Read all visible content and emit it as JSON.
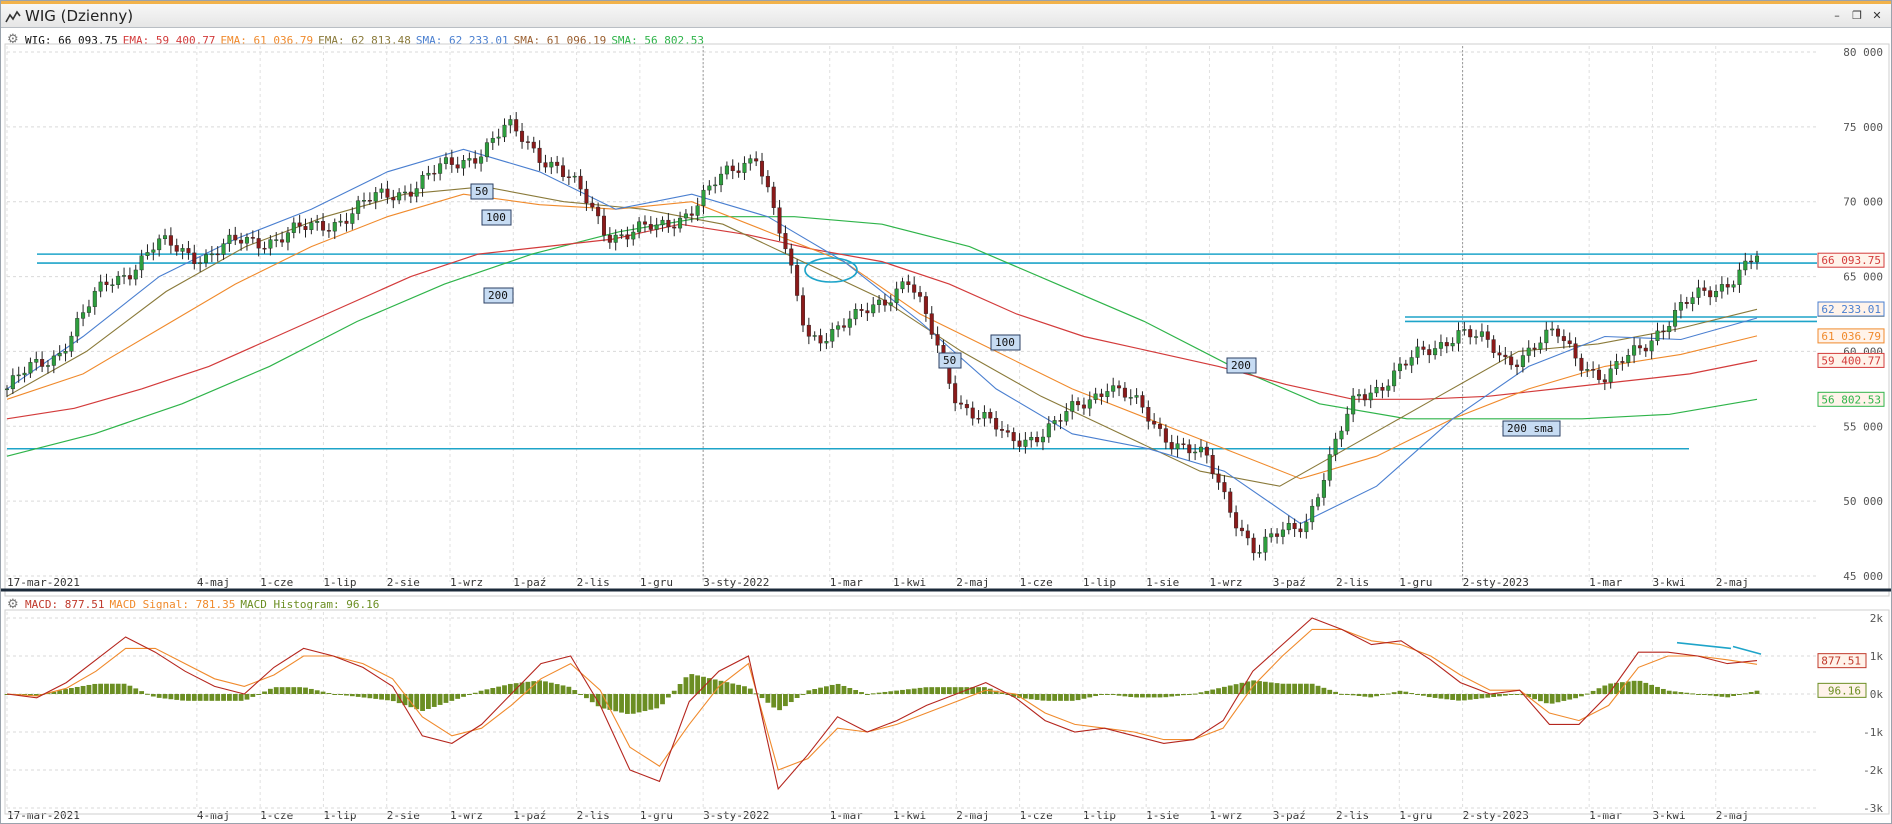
{
  "window": {
    "title": "WIG (Dzienny)",
    "buttons": [
      "–",
      "❐",
      "✕"
    ]
  },
  "legend_main": [
    {
      "text": "WIG: 66 093.75",
      "color": "#111111"
    },
    {
      "text": "EMA: 59 400.77",
      "color": "#d33b3b"
    },
    {
      "text": "EMA: 61 036.79",
      "color": "#f08a2c"
    },
    {
      "text": "EMA: 62 813.48",
      "color": "#8a7a3a"
    },
    {
      "text": "SMA: 62 233.01",
      "color": "#4a7fd0"
    },
    {
      "text": "SMA: 61 096.19",
      "color": "#9a5e2e"
    },
    {
      "text": "SMA: 56 802.53",
      "color": "#2fb44a"
    }
  ],
  "legend_macd": [
    {
      "text": "MACD: 877.51",
      "color": "#c0392b"
    },
    {
      "text": "MACD Signal: 781.35",
      "color": "#f08a2c"
    },
    {
      "text": "MACD Histogram: 96.16",
      "color": "#6b8e23"
    }
  ],
  "annotations": {
    "ma50_a": "50",
    "ma100_a": "100",
    "ma200_a": "200",
    "ma50_b": "50",
    "ma100_b": "100",
    "ma200_b": "200",
    "sma200": "200 sma"
  },
  "price_labels": [
    {
      "text": "66 093.75",
      "value": 66093.75,
      "color": "#d33b3b"
    },
    {
      "text": "62 813.48",
      "value": 62813.48,
      "color": "#8a7a3a"
    },
    {
      "text": "62 233.01",
      "value": 62233.01,
      "color": "#4a7fd0"
    },
    {
      "text": "61 036.79",
      "value": 61036.79,
      "color": "#f08a2c"
    },
    {
      "text": "59 400.77",
      "value": 59400.77,
      "color": "#d33b3b"
    },
    {
      "text": "56 802.53",
      "value": 56802.53,
      "color": "#2fb44a"
    }
  ],
  "macd_labels": [
    {
      "text": "877.51",
      "value": 877.51,
      "color": "#c0392b"
    },
    {
      "text": "96.16",
      "value": 96.16,
      "color": "#6b8e23"
    }
  ],
  "chart_data": [
    {
      "type": "line",
      "ylim": [
        45000,
        80000
      ],
      "y_ticks": [
        {
          "value": 80000,
          "label": "80 000"
        },
        {
          "value": 75000,
          "label": "75 000"
        },
        {
          "value": 70000,
          "label": "70 000"
        },
        {
          "value": 65000,
          "label": "65 000"
        },
        {
          "value": 60000,
          "label": "60 000"
        },
        {
          "value": 55000,
          "label": "55 000"
        },
        {
          "value": 50000,
          "label": "50 000"
        },
        {
          "value": 45000,
          "label": "45 000"
        }
      ],
      "x_ticks": [
        "17-mar-2021",
        "4-maj",
        "1-cze",
        "1-lip",
        "2-sie",
        "1-wrz",
        "1-paź",
        "2-lis",
        "1-gru",
        "3-sty-2022",
        "1-mar",
        "1-kwi",
        "2-maj",
        "1-cze",
        "1-lip",
        "1-sie",
        "1-wrz",
        "3-paź",
        "2-lis",
        "1-gru",
        "2-sty-2023",
        "1-mar",
        "3-kwi",
        "2-maj"
      ],
      "x_tick_pos": [
        0,
        3,
        4,
        5,
        6,
        7,
        8,
        9,
        10,
        11,
        13,
        14,
        15,
        16,
        17,
        18,
        19,
        20,
        21,
        22,
        23,
        25,
        26,
        27
      ],
      "month_count": 28.6,
      "wig": [
        57500,
        60000,
        64500,
        67000,
        66500,
        67500,
        68000,
        69500,
        71000,
        72500,
        74800,
        72500,
        68000,
        68000,
        70500,
        73500,
        61000,
        62000,
        65000,
        57000,
        54000,
        55000,
        58000,
        55000,
        52500,
        46500,
        49000,
        57000,
        59000,
        61500,
        59500,
        61000,
        58000,
        61500,
        64000,
        66094
      ],
      "ema_red": [
        55500,
        56200,
        57500,
        59000,
        61000,
        63000,
        65000,
        66500,
        67000,
        67500,
        68500,
        67800,
        66800,
        66000,
        64500,
        62500,
        61000,
        60000,
        59000,
        57800,
        56800,
        56800,
        57000,
        57500,
        58000,
        58500,
        59401
      ],
      "ema_orange": [
        56800,
        58500,
        61500,
        64500,
        67000,
        69000,
        70500,
        69800,
        69500,
        70000,
        68000,
        66000,
        62500,
        60000,
        57500,
        55500,
        53500,
        51500,
        53000,
        55500,
        57500,
        59000,
        59800,
        61037
      ],
      "ema_olive": [
        57000,
        60000,
        64000,
        67000,
        69000,
        70500,
        71000,
        70000,
        69500,
        68500,
        66000,
        63500,
        60000,
        57000,
        54500,
        52000,
        51000,
        54000,
        57000,
        60000,
        60500,
        61500,
        62813
      ],
      "sma_blue": [
        57500,
        61000,
        65000,
        67500,
        69500,
        72000,
        73500,
        72000,
        69500,
        70500,
        69000,
        66000,
        62000,
        57500,
        54500,
        53500,
        52000,
        48500,
        51000,
        55500,
        59000,
        61000,
        60800,
        62233
      ],
      "sma_green": [
        53000,
        54500,
        56500,
        59000,
        62000,
        64500,
        66500,
        68000,
        69000,
        69000,
        68500,
        67000,
        64500,
        62000,
        59000,
        56500,
        55500,
        55500,
        55500,
        55800,
        56802
      ],
      "h_levels": [
        66500,
        65900,
        53500,
        62300,
        62000
      ]
    },
    {
      "type": "bar",
      "name_macd": "MACD",
      "ylim": [
        -3000,
        2000
      ],
      "y_ticks": [
        {
          "value": 2000,
          "label": "2k"
        },
        {
          "value": 1000,
          "label": "1k"
        },
        {
          "value": 0,
          "label": "0k"
        },
        {
          "value": -1000,
          "label": "-1k"
        },
        {
          "value": -2000,
          "label": "-2k"
        },
        {
          "value": -3000,
          "label": "-3k"
        }
      ],
      "macd": [
        0,
        -100,
        300,
        900,
        1500,
        1100,
        600,
        200,
        0,
        700,
        1200,
        1000,
        700,
        200,
        -1100,
        -1300,
        -800,
        0,
        800,
        1000,
        -300,
        -2000,
        -2300,
        -200,
        600,
        1000,
        -2500,
        -1600,
        -600,
        -1000,
        -700,
        -300,
        0,
        300,
        -100,
        -700,
        -1000,
        -900,
        -1100,
        -1300,
        -1200,
        -700,
        600,
        1300,
        2000,
        1700,
        1300,
        1400,
        900,
        300,
        0,
        100,
        -800,
        -800,
        0,
        1100,
        1100,
        1000,
        800,
        878
      ],
      "signal": [
        0,
        -50,
        150,
        600,
        1200,
        1200,
        800,
        400,
        200,
        500,
        1000,
        1000,
        800,
        400,
        -600,
        -1100,
        -900,
        -300,
        400,
        800,
        100,
        -1400,
        -1900,
        -800,
        200,
        800,
        -2000,
        -1700,
        -900,
        -1000,
        -800,
        -500,
        -200,
        100,
        0,
        -500,
        -800,
        -900,
        -1000,
        -1200,
        -1200,
        -900,
        200,
        1000,
        1700,
        1700,
        1400,
        1300,
        1000,
        500,
        100,
        100,
        -500,
        -700,
        -300,
        700,
        1000,
        1000,
        900,
        781
      ],
      "hist_last": 96.16
    }
  ]
}
